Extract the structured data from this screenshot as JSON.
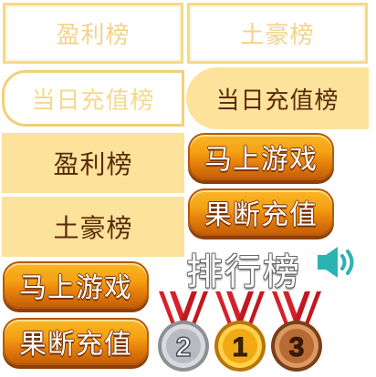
{
  "tabs": {
    "profit_outline": "盈利榜",
    "tycoon_outline": "土豪榜",
    "daily_recharge_outline": "当日充值榜",
    "daily_recharge_solid": "当日充值榜",
    "profit_solid": "盈利榜",
    "tycoon_solid": "土豪榜"
  },
  "buttons": {
    "play_now": "马上游戏",
    "recharge": "果断充值",
    "play_now_2": "马上游戏",
    "recharge_2": "果断充值"
  },
  "leaderboard": {
    "title": "排行榜",
    "sound_icon": "speaker-icon"
  },
  "medals": [
    {
      "rank": "2",
      "metal": "silver"
    },
    {
      "rank": "1",
      "metal": "gold"
    },
    {
      "rank": "3",
      "metal": "bronze"
    }
  ],
  "colors": {
    "tab_fill": "#fde29b",
    "tab_text": "#5a2a08",
    "button_orange": "#f5a114",
    "sound_teal": "#2bb3b1"
  }
}
